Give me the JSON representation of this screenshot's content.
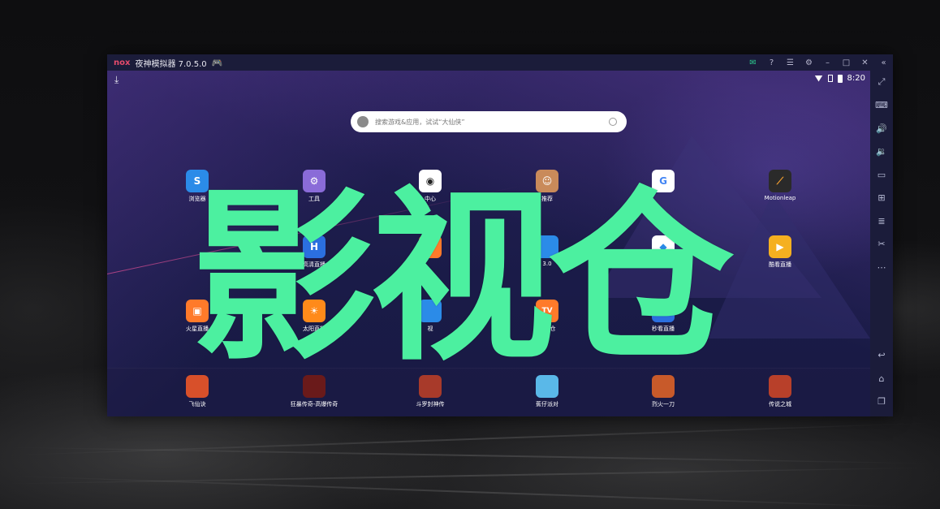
{
  "window": {
    "logo": "nox",
    "title": "夜神模拟器 7.0.5.0",
    "titlebar_icons": [
      "mail-icon",
      "help-icon",
      "menu-icon",
      "settings-icon",
      "minimize-icon",
      "maximize-icon",
      "close-icon",
      "collapse-icon"
    ]
  },
  "status_bar": {
    "time": "8:20"
  },
  "search": {
    "placeholder": "搜索游戏&应用，试试“大仙侠”"
  },
  "apps": [
    {
      "label": "浏览器",
      "color": "#2b8be8"
    },
    {
      "label": "工具",
      "color": "#8a6bd8"
    },
    {
      "label": "中心",
      "color": "#ffffff"
    },
    {
      "label": "推荐",
      "color": "#c98a5a"
    },
    {
      "label": "",
      "color": "#ffffff"
    },
    {
      "label": "Motionleap",
      "color": "#2a2a2a"
    },
    {
      "label": "高清直播",
      "color": "#2b6fe0"
    },
    {
      "label": "",
      "color": "#ff7a2a"
    },
    {
      "label": "3.0",
      "color": "#2b8be8"
    },
    {
      "label": "",
      "color": "#ffffff"
    },
    {
      "label": "酷看直播",
      "color": "#f5b020"
    },
    {
      "label": "火星直播",
      "color": "#ff7a2a"
    },
    {
      "label": "太阳直播",
      "color": "#ff8a1a"
    },
    {
      "label": "视",
      "color": "#2b8be8"
    },
    {
      "label": "影视仓",
      "color": "#ff7a2a"
    },
    {
      "label": "秒看直播",
      "color": "#2b6fe0"
    }
  ],
  "dock": [
    {
      "label": "飞仙诀",
      "color": "#d8502a"
    },
    {
      "label": "狂暴传奇-高爆传奇",
      "color": "#6a1a1a"
    },
    {
      "label": "斗罗封神传",
      "color": "#a83a2a"
    },
    {
      "label": "蕉仔派对",
      "color": "#5ab8e8"
    },
    {
      "label": "烈火一刀",
      "color": "#c85a2a"
    },
    {
      "label": "传说之城",
      "color": "#b8402a"
    }
  ],
  "sidebar_icons": [
    "fullscreen-icon",
    "keyboard-icon",
    "volume-up-icon",
    "volume-down-icon",
    "screen-icon",
    "add-apk-icon",
    "multi-instance-icon",
    "scissors-icon",
    "more-icon"
  ],
  "sidebar_bottom_icons": [
    "back-icon",
    "home-icon",
    "recents-icon"
  ],
  "overlay": {
    "title": "影视仓"
  }
}
